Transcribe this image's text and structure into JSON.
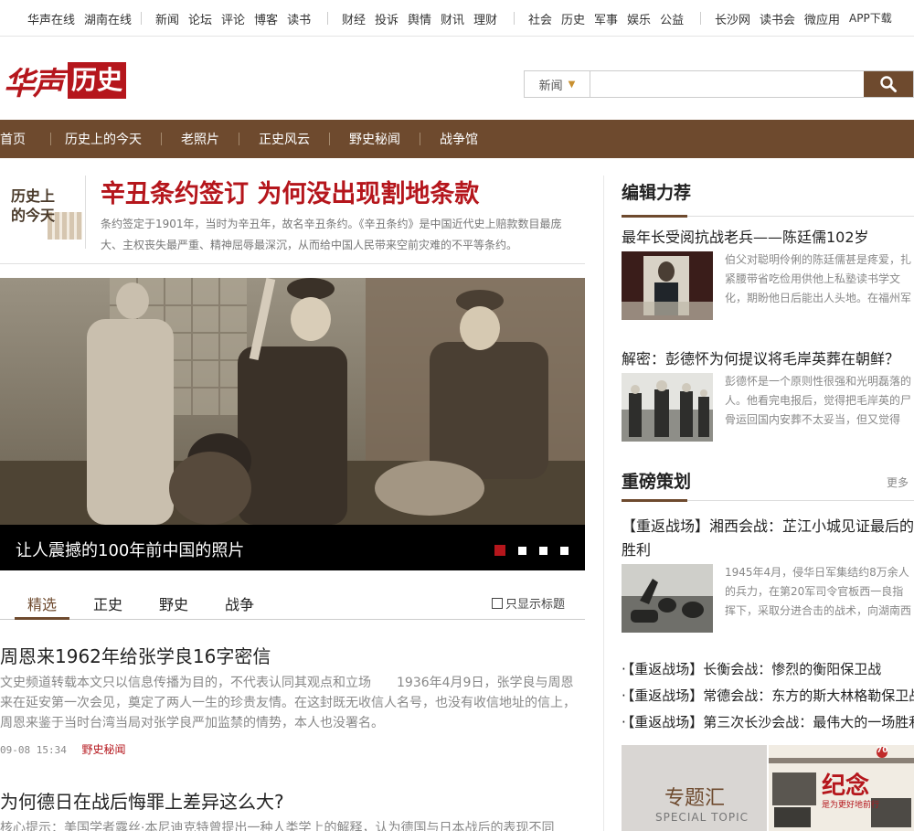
{
  "topnav": {
    "group1": [
      "华声在线",
      "湖南在线"
    ],
    "group2": [
      "新闻",
      "论坛",
      "评论",
      "博客",
      "读书"
    ],
    "group3": [
      "财经",
      "投诉",
      "舆情",
      "财讯",
      "理财"
    ],
    "group4": [
      "社会",
      "历史",
      "军事",
      "娱乐",
      "公益"
    ],
    "group5": [
      "长沙网",
      "读书会",
      "微应用",
      "APP下载"
    ]
  },
  "logo": {
    "brand": "华声",
    "section": "历史"
  },
  "search": {
    "scope": "新闻",
    "placeholder": ""
  },
  "mainnav": [
    "首页",
    "历史上的今天",
    "老照片",
    "正史风云",
    "野史秘闻",
    "战争馆"
  ],
  "today": {
    "badge": "历史上的今天",
    "badge_line1": "历史上",
    "badge_line2": "的今天",
    "headline": "辛丑条约签订 为何没出现割地条款",
    "summary": "条约签定于1901年，当时为辛丑年，故名辛丑条约。《辛丑条约》是中国近代史上赔款数目最庞大、主权丧失最严重、精神屈辱最深沉，从而给中国人民带来空前灾难的不平等条约。"
  },
  "hero": {
    "caption": "让人震撼的100年前中国的照片",
    "slide_count": 4,
    "active_slide": 1
  },
  "tabs": {
    "items": [
      "精选",
      "正史",
      "野史",
      "战争"
    ],
    "active": 0,
    "checkbox_label": "只显示标题"
  },
  "articles": [
    {
      "title": "周恩来1962年给张学良16字密信",
      "body": "文史频道转载本文只以信息传播为目的，不代表认同其观点和立场　　1936年4月9日，张学良与周恩来在延安第一次会见，奠定了两人一生的珍贵友情。在这封既无收信人名号，也没有收信地址的信上，周恩来鉴于当时台湾当局对张学良严加监禁的情势，本人也没署名。",
      "date": "09-08 15:34",
      "category": "野史秘闻"
    },
    {
      "title": "为何德日在战后悔罪上差异这么大?",
      "body": "核心提示：美国学者露丝·本尼迪克特曾提出一种人类学上的解释，认为德国与日本战后的表现不同"
    }
  ],
  "editor": {
    "title": "编辑力荐",
    "items": [
      {
        "title": "最年长受阅抗战老兵——陈廷儒102岁",
        "text": "伯父对聪明伶俐的陈廷儒甚是疼爱，扎紧腰带省吃俭用供他上私塾读书学文化，期盼他日后能出人头地。在福州军"
      },
      {
        "title": "解密：彭德怀为何提议将毛岸英葬在朝鲜？",
        "text": "彭德怀是一个原则性很强和光明磊落的人。他看完电报后，觉得把毛岸英的尸骨运回国内安葬不太妥当，但又觉得"
      }
    ]
  },
  "feature": {
    "title": "重磅策划",
    "more": "更多",
    "lead_title_line1": "【重返战场】湘西会战：芷江小城见证最后的",
    "lead_title_line2": "胜利",
    "lead_text": "1945年4月，侵华日军集结约8万余人的兵力，在第20军司令官板西一良指挥下，采取分进合击的战术，向湖南西部",
    "links": [
      "【重返战场】长衡会战：惨烈的衡阳保卫战",
      "【重返战场】常德会战：东方的斯大林格勒保卫战",
      "【重返战场】第三次长沙会战：最伟大的一场胜利"
    ],
    "special_cn": "专题汇",
    "special_en": "SPECIAL TOPIC",
    "poster_text": "纪念",
    "poster_sub": "是为更好地前行",
    "poster_badge": "70"
  },
  "colors": {
    "brand_red": "#b5161c",
    "nav_brown": "#6e4a2e"
  }
}
